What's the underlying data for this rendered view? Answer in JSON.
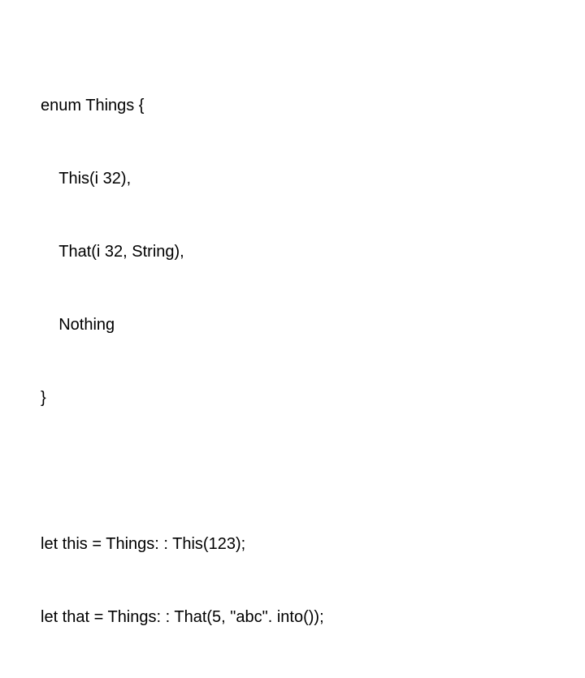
{
  "code": {
    "enum_decl_open": "enum Things {",
    "variant1": "This(i 32),",
    "variant2": "That(i 32, String),",
    "variant3": "Nothing",
    "enum_decl_close": "}",
    "let_this": "let this = Things: : This(123);",
    "let_that": "let that = Things: : That(5, \"abc\". into());"
  }
}
